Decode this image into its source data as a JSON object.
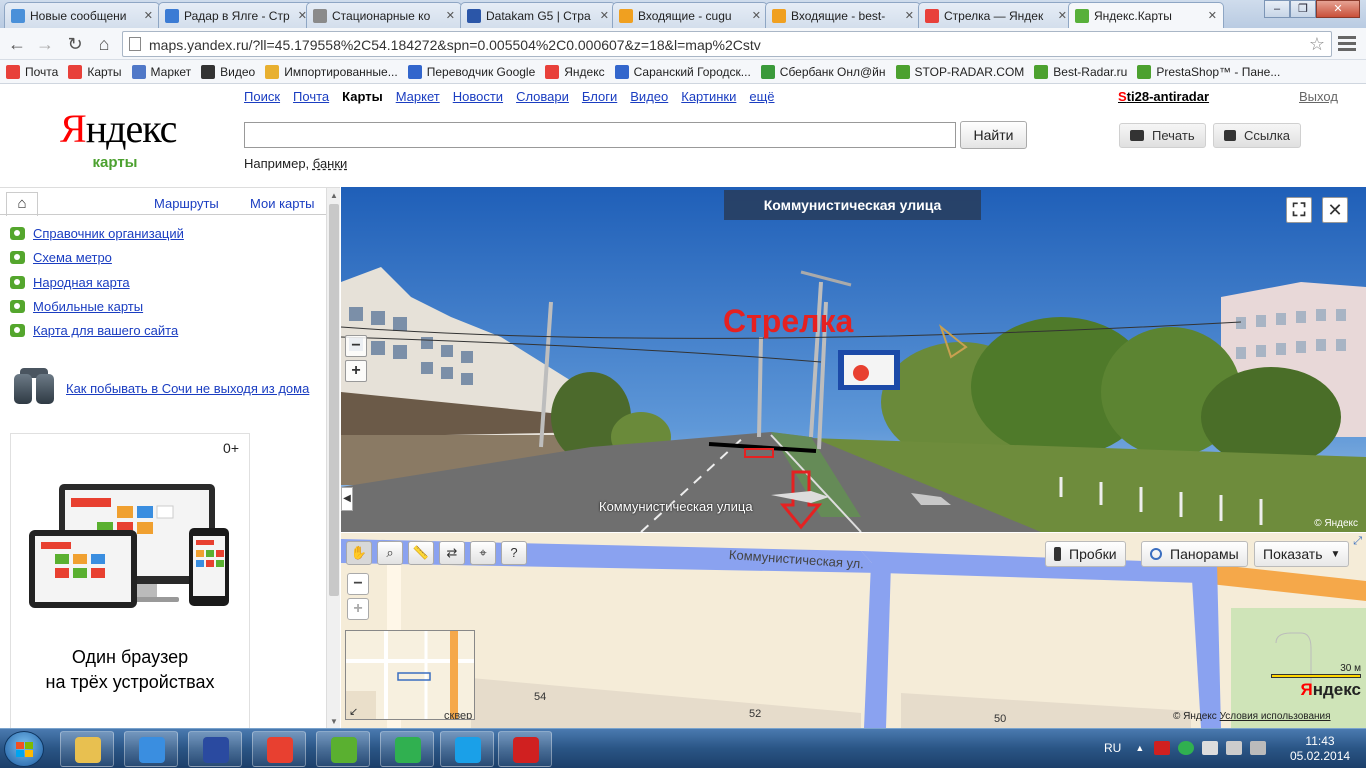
{
  "browser": {
    "tabs": [
      {
        "title": "Новые сообщени",
        "color": "#4a90d9"
      },
      {
        "title": "Радар в Ялге - Стр",
        "color": "#3b7bd4"
      },
      {
        "title": "Стационарные ко",
        "color": "#8a8a8a"
      },
      {
        "title": "Datakam G5 | Стра",
        "color": "#2b56a8"
      },
      {
        "title": "Входящие - cugu",
        "color": "#f0a020"
      },
      {
        "title": "Входящие - best-",
        "color": "#f0a020"
      },
      {
        "title": "Стрелка — Яндек",
        "color": "#e8403a"
      },
      {
        "title": "Яндекс.Карты",
        "color": "#58b03a"
      }
    ],
    "address": "maps.yandex.ru/?ll=45.179558%2C54.184272&spn=0.005504%2C0.000607&z=18&l=map%2Cstv",
    "bookmarks": [
      {
        "label": "Почта",
        "color": "#e8403a"
      },
      {
        "label": "Карты",
        "color": "#e8403a"
      },
      {
        "label": "Маркет",
        "color": "#5078c8"
      },
      {
        "label": "Видео",
        "color": "#333333"
      },
      {
        "label": "Импортированные...",
        "color": "#e8b030"
      },
      {
        "label": "Переводчик Google",
        "color": "#3366cc"
      },
      {
        "label": "Яндекс",
        "color": "#e8403a"
      },
      {
        "label": "Саранский Городск...",
        "color": "#3366cc"
      },
      {
        "label": "Сбербанк Онл@йн",
        "color": "#3a9a3a"
      },
      {
        "label": "STOP-RADAR.COM",
        "color": "#4ca12f"
      },
      {
        "label": "Best-Radar.ru",
        "color": "#4ca12f"
      },
      {
        "label": "PrestaShop™ - Пане...",
        "color": "#4ca12f"
      }
    ]
  },
  "header": {
    "logo": "Яндекс",
    "logo_sub": "карты",
    "services": [
      "Поиск",
      "Почта",
      "Карты",
      "Маркет",
      "Новости",
      "Словари",
      "Блоги",
      "Видео",
      "Картинки",
      "ещё"
    ],
    "active_service": "Карты",
    "user": "Sti28-antiradar",
    "logout": "Выход",
    "search_value": "",
    "find_button": "Найти",
    "example_prefix": "Например,",
    "example_link": "банки",
    "print_button": "Печать",
    "link_button": "Ссылка"
  },
  "sidebar": {
    "tabs": [
      "Маршруты",
      "Мои карты"
    ],
    "links": [
      "Справочник организаций",
      "Схема метро",
      "Народная карта",
      "Мобильные карты",
      "Карта для вашего сайта"
    ],
    "promo_link": "Как побывать в Сочи не выходя из дома",
    "ad": {
      "age": "0+",
      "line1": "Один браузер",
      "line2": "на трёх устройствах"
    }
  },
  "panorama": {
    "title": "Коммунистическая улица",
    "road_label": "Коммунистическая улица",
    "annotation": "Стрелка",
    "copyright": "© Яндекс"
  },
  "map": {
    "tools": [
      "hand-tool-icon",
      "zoom-tool-icon",
      "ruler-tool-icon",
      "route-tool-icon",
      "marker-tool-icon",
      "info-tool-icon"
    ],
    "traffic_button": "Пробки",
    "panorama_button": "Панорамы",
    "show_button": "Показать",
    "street": "Коммунистическая ул.",
    "houses": [
      "54",
      "52",
      "50"
    ],
    "minimap_label": "сквер",
    "scale": "30 м",
    "logo": "Яндекс",
    "copyright": "© Яндекс",
    "terms": "Условия использования"
  },
  "taskbar": {
    "apps": [
      {
        "name": "explorer",
        "color": "#e8c050"
      },
      {
        "name": "internet-explorer",
        "color": "#3a8ee0"
      },
      {
        "name": "save",
        "color": "#2a4aa0"
      },
      {
        "name": "chrome",
        "color": "#e84030"
      },
      {
        "name": "icq",
        "color": "#5ab030"
      },
      {
        "name": "mail-agent",
        "color": "#30b050"
      },
      {
        "name": "skype",
        "color": "#1aa0e8"
      },
      {
        "name": "kaspersky",
        "color": "#d02020"
      }
    ],
    "lang": "RU",
    "time": "11:43",
    "date": "05.02.2014"
  },
  "colors": {
    "link": "#1a3dc1",
    "accent_green": "#4ca12f",
    "yandex_red": "#ff0000",
    "road_blue": "#8aa2f0",
    "road_orange": "#f5a84a"
  }
}
